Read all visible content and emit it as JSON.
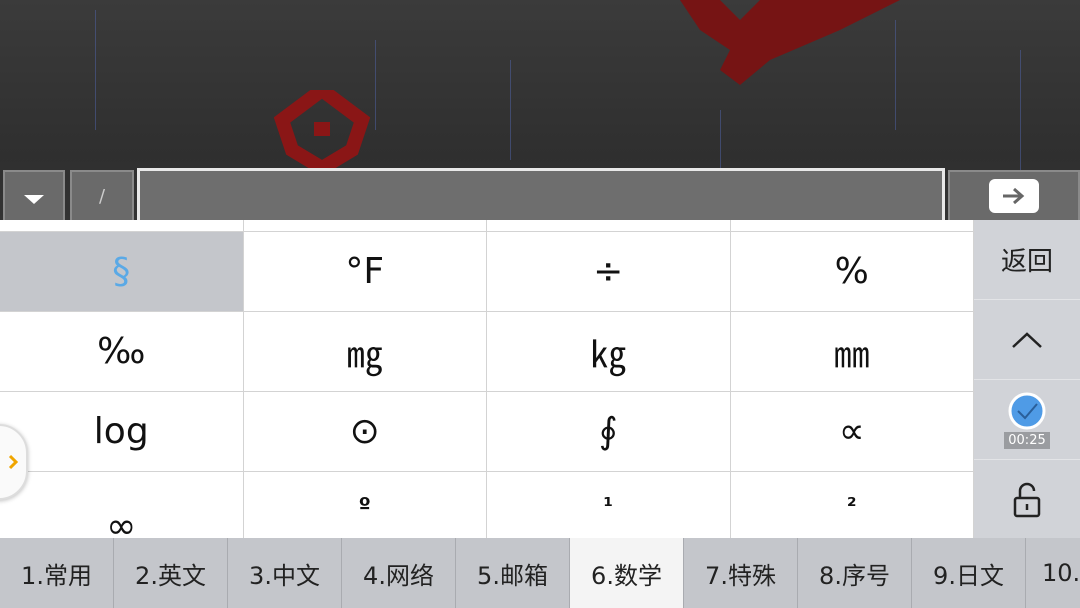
{
  "chat": {
    "slash_label": "/",
    "input_value": ""
  },
  "keyboard": {
    "rows": [
      [
        "§",
        "°F",
        "÷",
        "%"
      ],
      [
        "‰",
        "㎎",
        "㎏",
        "㎜"
      ],
      [
        "log",
        "⊙",
        "∮",
        "∝"
      ],
      [
        "∞",
        "º",
        "¹",
        "²"
      ]
    ],
    "selected_key": "§",
    "side": {
      "back_label": "返回",
      "timer": "00:25"
    },
    "tabs": [
      "1.常用",
      "2.英文",
      "3.中文",
      "4.网络",
      "5.邮箱",
      "6.数学",
      "7.特殊",
      "8.序号",
      "9.日文",
      "10."
    ],
    "active_tab": "6.数学",
    "colors": {
      "selected_text": "#5aa9e6",
      "accent_blue": "#4f9be6"
    }
  }
}
